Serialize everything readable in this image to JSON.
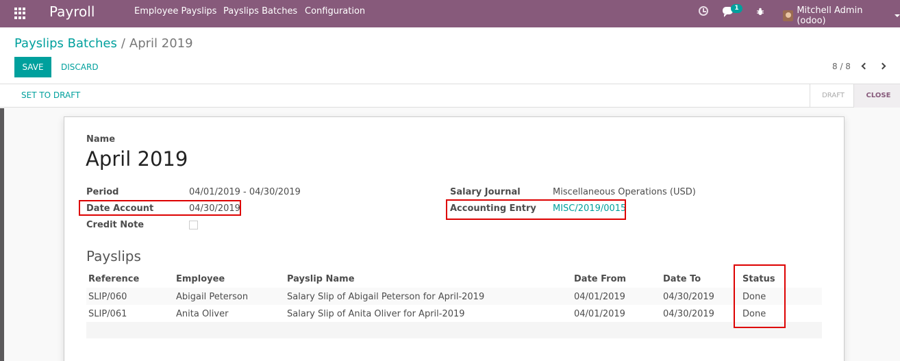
{
  "topnav": {
    "app_name": "Payroll",
    "menus": [
      "Employee Payslips",
      "Payslips Batches",
      "Configuration"
    ],
    "chat_badge": "1",
    "user": "Mitchell Admin (odoo)",
    "bar_color": "#875a7b"
  },
  "breadcrumb": {
    "parent": "Payslips Batches",
    "separator": "/",
    "current": "April 2019"
  },
  "actions": {
    "save": "SAVE",
    "discard": "DISCARD",
    "pager": "8 / 8"
  },
  "statusbar": {
    "set_to_draft": "SET TO DRAFT",
    "stages": [
      "DRAFT",
      "CLOSE"
    ],
    "active_stage": "CLOSE"
  },
  "form": {
    "name_label": "Name",
    "name_value": "April 2019",
    "period_label": "Period",
    "period_value": "04/01/2019 - 04/30/2019",
    "date_account_label": "Date Account",
    "date_account_value": "04/30/2019",
    "credit_note_label": "Credit Note",
    "salary_journal_label": "Salary Journal",
    "salary_journal_value": "Miscellaneous Operations (USD)",
    "accounting_entry_label": "Accounting Entry",
    "accounting_entry_value": "MISC/2019/0015"
  },
  "payslips": {
    "title": "Payslips",
    "columns": [
      "Reference",
      "Employee",
      "Payslip Name",
      "Date From",
      "Date To",
      "Status"
    ],
    "rows": [
      [
        "SLIP/060",
        "Abigail Peterson",
        "Salary Slip of Abigail Peterson for April-2019",
        "04/01/2019",
        "04/30/2019",
        "Done"
      ],
      [
        "SLIP/061",
        "Anita Oliver",
        "Salary Slip of Anita Oliver for April-2019",
        "04/01/2019",
        "04/30/2019",
        "Done"
      ]
    ]
  },
  "colors": {
    "accent": "#00a09d",
    "highlight_box": "#dd0000"
  }
}
